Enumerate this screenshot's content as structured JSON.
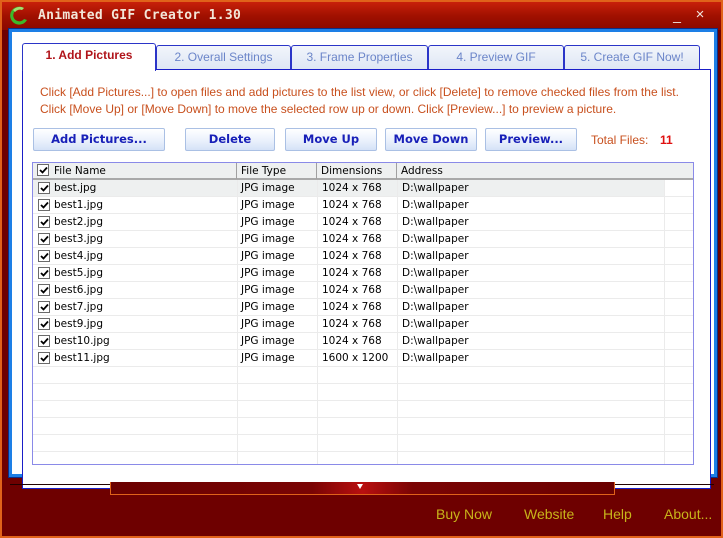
{
  "window": {
    "title": "Animated GIF Creator 1.30",
    "minimize_label": "_",
    "close_label": "×"
  },
  "tabs": [
    {
      "label": "1. Add Pictures",
      "active": true
    },
    {
      "label": "2. Overall Settings",
      "active": false
    },
    {
      "label": "3. Frame Properties",
      "active": false
    },
    {
      "label": "4. Preview GIF",
      "active": false
    },
    {
      "label": "5. Create GIF Now!",
      "active": false
    }
  ],
  "instructions": {
    "line1": "Click [Add Pictures...] to open files and add pictures to the list view, or click [Delete] to remove checked files from the list.",
    "line2": "Click [Move Up] or [Move Down] to move the selected row up or down. Click [Preview...] to preview a picture."
  },
  "toolbar": {
    "add_pictures": "Add Pictures...",
    "delete": "Delete",
    "move_up": "Move Up",
    "move_down": "Move Down",
    "preview": "Preview...",
    "total_label": "Total Files:",
    "total_value": "11"
  },
  "list": {
    "columns": [
      "File Name",
      "File Type",
      "Dimensions",
      "Address"
    ],
    "header_checked": true,
    "rows": [
      {
        "name": "best.jpg",
        "type": "JPG image",
        "dim": "1024 x 768",
        "addr": "D:\\wallpaper",
        "checked": true,
        "selected": true
      },
      {
        "name": "best1.jpg",
        "type": "JPG image",
        "dim": "1024 x 768",
        "addr": "D:\\wallpaper",
        "checked": true
      },
      {
        "name": "best2.jpg",
        "type": "JPG image",
        "dim": "1024 x 768",
        "addr": "D:\\wallpaper",
        "checked": true
      },
      {
        "name": "best3.jpg",
        "type": "JPG image",
        "dim": "1024 x 768",
        "addr": "D:\\wallpaper",
        "checked": true
      },
      {
        "name": "best4.jpg",
        "type": "JPG image",
        "dim": "1024 x 768",
        "addr": "D:\\wallpaper",
        "checked": true
      },
      {
        "name": "best5.jpg",
        "type": "JPG image",
        "dim": "1024 x 768",
        "addr": "D:\\wallpaper",
        "checked": true
      },
      {
        "name": "best6.jpg",
        "type": "JPG image",
        "dim": "1024 x 768",
        "addr": "D:\\wallpaper",
        "checked": true
      },
      {
        "name": "best7.jpg",
        "type": "JPG image",
        "dim": "1024 x 768",
        "addr": "D:\\wallpaper",
        "checked": true
      },
      {
        "name": "best9.jpg",
        "type": "JPG image",
        "dim": "1024 x 768",
        "addr": "D:\\wallpaper",
        "checked": true
      },
      {
        "name": "best10.jpg",
        "type": "JPG image",
        "dim": "1024 x 768",
        "addr": "D:\\wallpaper",
        "checked": true
      },
      {
        "name": "best11.jpg",
        "type": "JPG image",
        "dim": "1600 x 1200",
        "addr": "D:\\wallpaper",
        "checked": true
      }
    ]
  },
  "footer": {
    "buy_now": "Buy Now",
    "website": "Website",
    "help": "Help",
    "about": "About..."
  },
  "colors": {
    "frame": "#6e0000",
    "accent_blue": "#1d7fe6",
    "instruction_text": "#c8501e",
    "footer_link": "#c8b41a",
    "active_tab": "#b0141a"
  }
}
